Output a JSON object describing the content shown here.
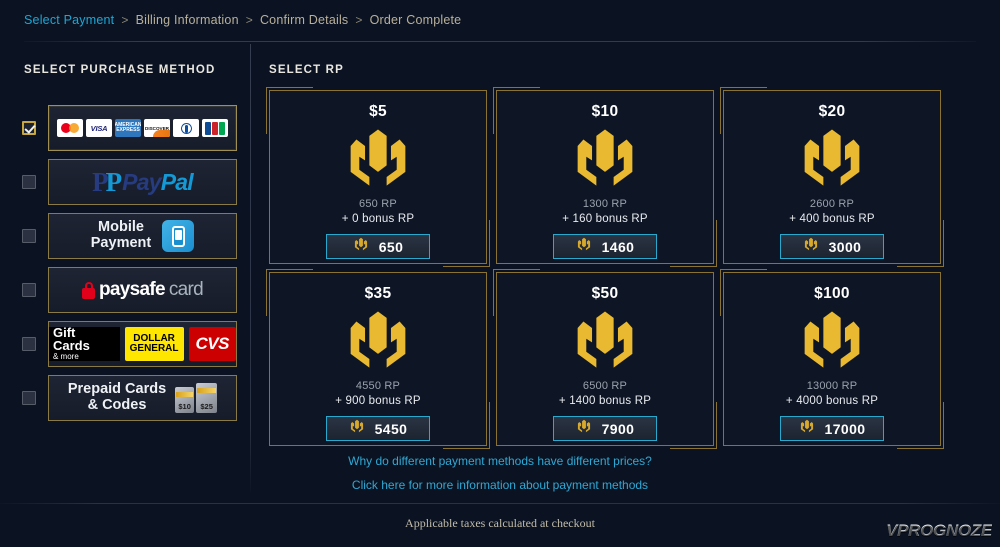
{
  "breadcrumb": {
    "separator": ">",
    "items": [
      {
        "label": "Select Payment",
        "active": true
      },
      {
        "label": "Billing Information",
        "active": false
      },
      {
        "label": "Confirm Details",
        "active": false
      },
      {
        "label": "Order Complete",
        "active": false
      }
    ]
  },
  "headings": {
    "left": "SELECT PURCHASE METHOD",
    "right": "SELECT RP"
  },
  "payment_methods": [
    {
      "name": "credit-cards",
      "checked": true,
      "brands": [
        "Mastercard",
        "VISA",
        "AMERICAN EXPRESS",
        "DISCOVER",
        "Diners Club",
        "JCB"
      ]
    },
    {
      "name": "paypal",
      "checked": false,
      "logo_a": "Pay",
      "logo_b": "Pal"
    },
    {
      "name": "mobile-payment",
      "checked": false,
      "line1": "Mobile",
      "line2": "Payment"
    },
    {
      "name": "paysafecard",
      "checked": false,
      "text_a": "paysafe",
      "text_b": "card"
    },
    {
      "name": "gift-cards",
      "checked": false,
      "title": "Gift Cards",
      "subtitle": "& more",
      "brand_1_line1": "DOLLAR",
      "brand_1_line2": "GENERAL",
      "brand_2": "CVS"
    },
    {
      "name": "prepaid-cards",
      "checked": false,
      "line1": "Prepaid Cards",
      "line2": "& Codes",
      "card_a": "$10",
      "card_b": "$25"
    }
  ],
  "rp_packages": [
    {
      "price": "$5",
      "base": "650 RP",
      "bonus": "+ 0 bonus RP",
      "total": "650"
    },
    {
      "price": "$10",
      "base": "1300 RP",
      "bonus": "+ 160 bonus RP",
      "total": "1460"
    },
    {
      "price": "$20",
      "base": "2600 RP",
      "bonus": "+ 400 bonus RP",
      "total": "3000"
    },
    {
      "price": "$35",
      "base": "4550 RP",
      "bonus": "+ 900 bonus RP",
      "total": "5450"
    },
    {
      "price": "$50",
      "base": "6500 RP",
      "bonus": "+ 1400 bonus RP",
      "total": "7900"
    },
    {
      "price": "$100",
      "base": "13000 RP",
      "bonus": "+ 4000 bonus RP",
      "total": "17000"
    }
  ],
  "footer": {
    "link_1": "Why do different payment methods have different prices?",
    "link_2": "Click here for more information about payment methods",
    "tax_note": "Applicable taxes calculated at checkout",
    "watermark": "VPROGNOZE"
  },
  "colors": {
    "background": "#0b1322",
    "accent_cyan": "#2fa8d4",
    "accent_gold": "#e0b game",
    "gold_border": "#8a7233",
    "rp_gold": "#e8b931"
  }
}
